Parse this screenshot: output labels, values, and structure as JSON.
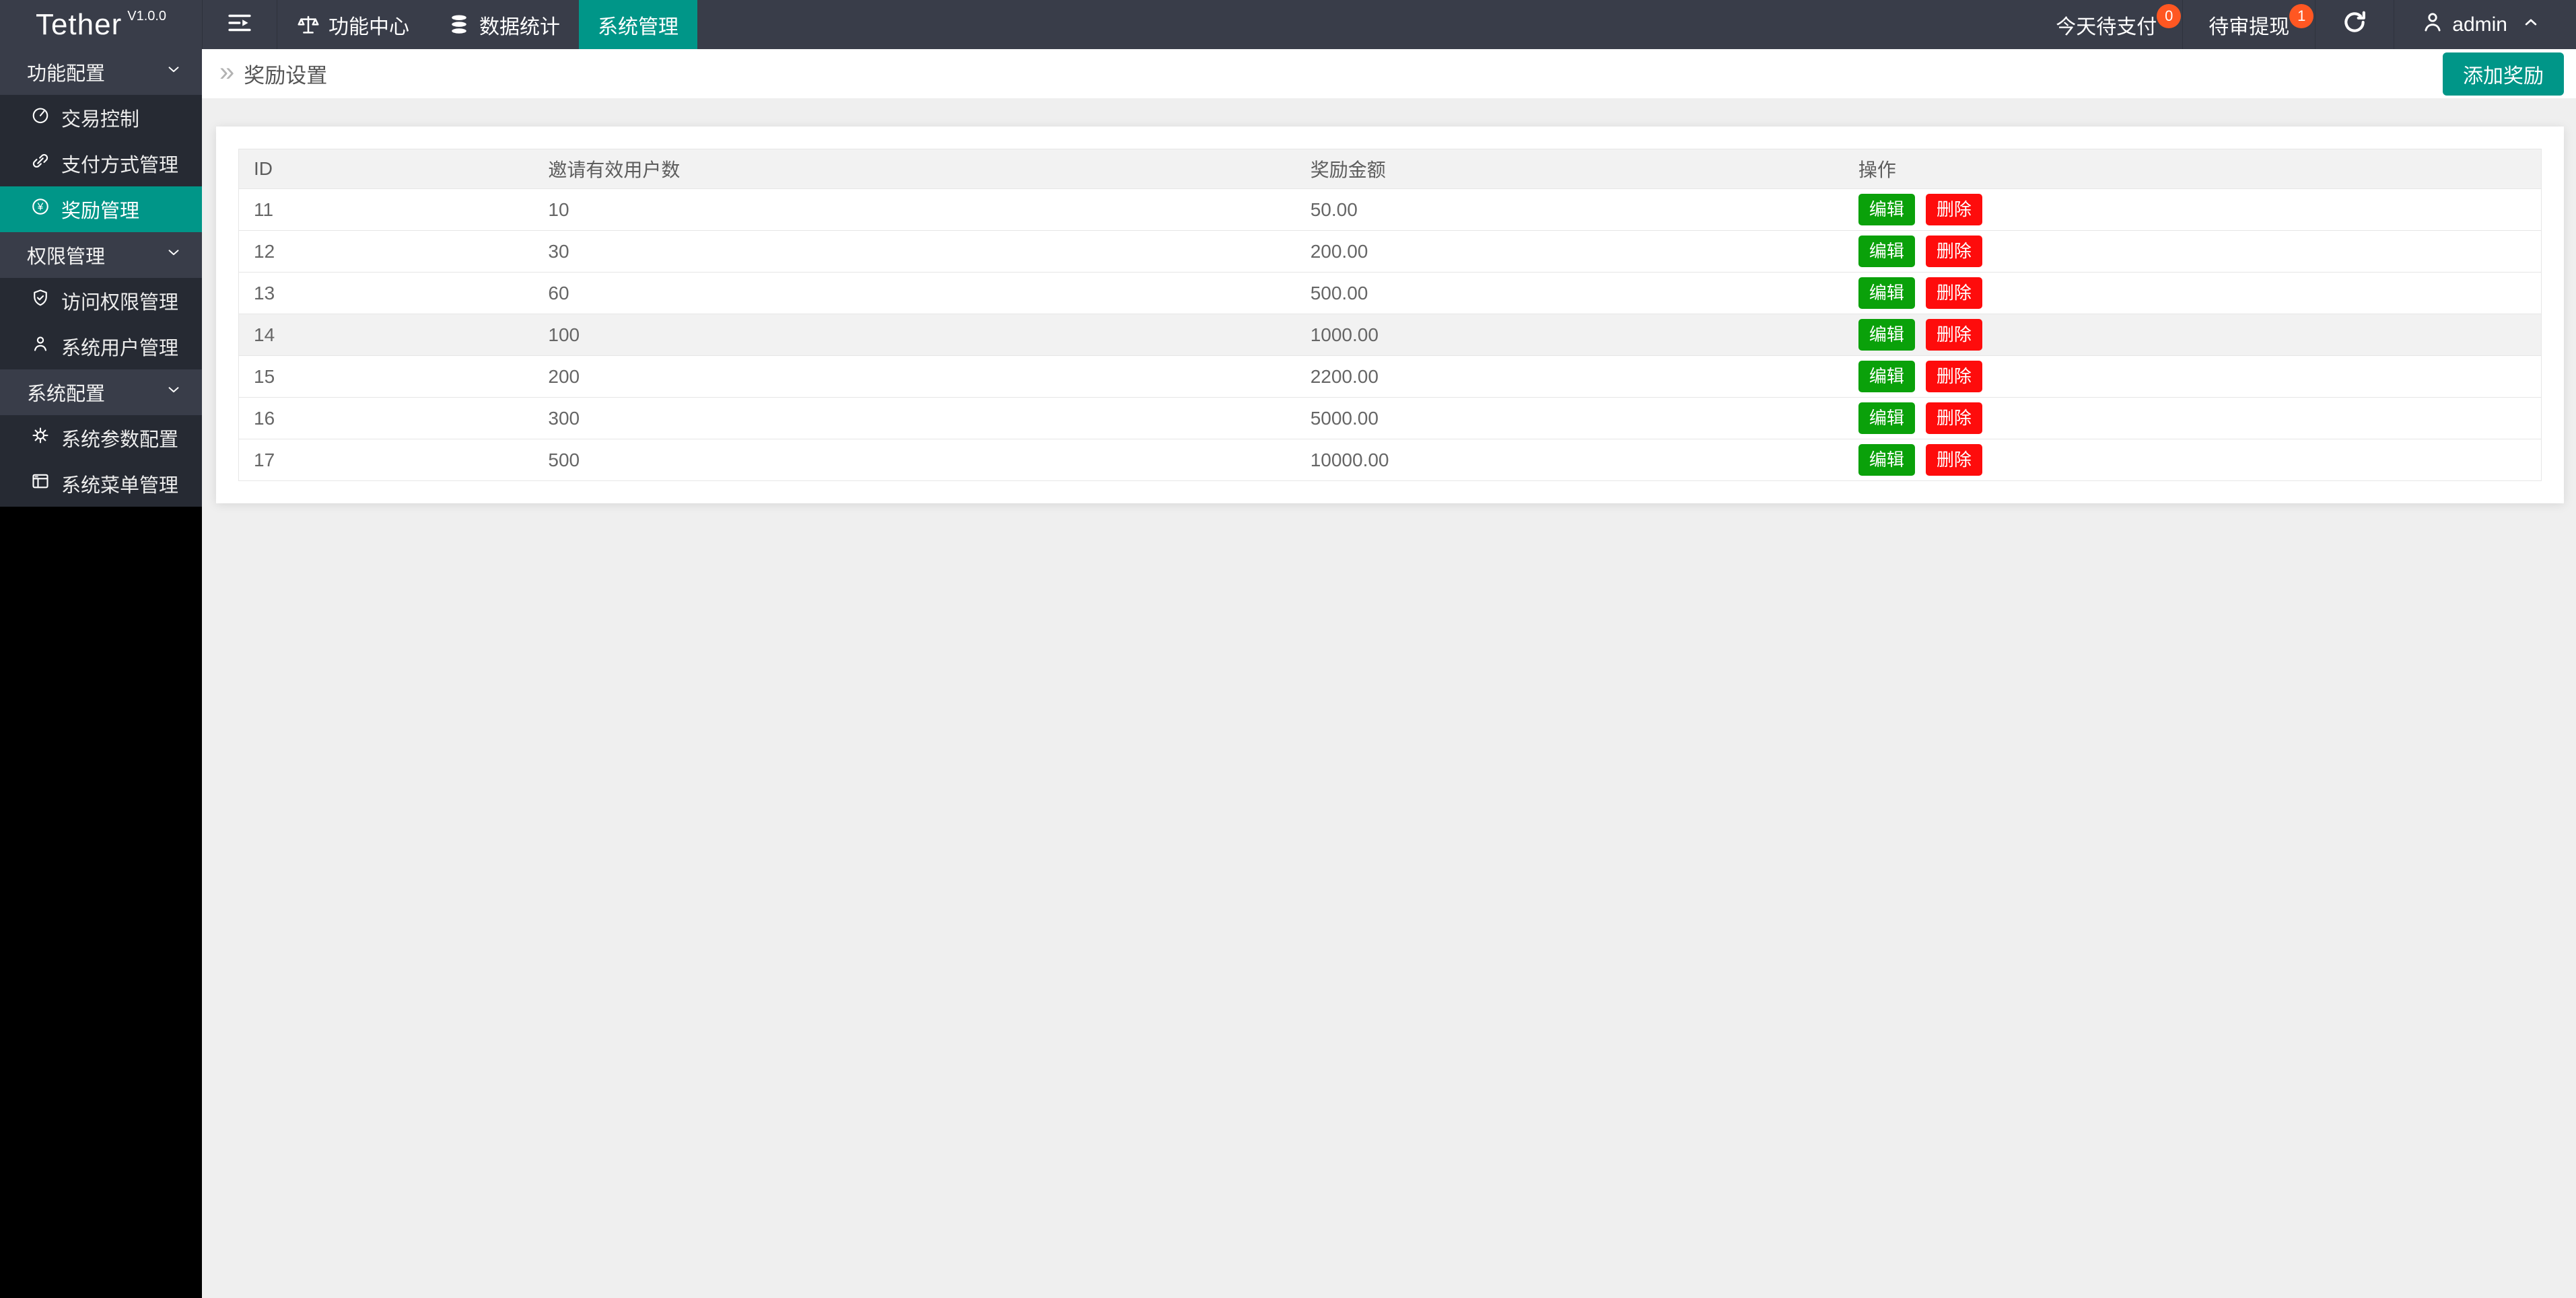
{
  "brand": {
    "name": "Tether",
    "version": "V1.0.0"
  },
  "topnav": {
    "items": [
      {
        "label": "功能中心",
        "icon": "scale-icon",
        "active": false
      },
      {
        "label": "数据统计",
        "icon": "database-icon",
        "active": false
      },
      {
        "label": "系统管理",
        "icon": null,
        "active": true
      }
    ]
  },
  "topright": {
    "pay_today": {
      "label": "今天待支付",
      "badge": "0"
    },
    "withdraw_review": {
      "label": "待审提现",
      "badge": "1"
    },
    "username": "admin"
  },
  "sidebar": {
    "sections": [
      {
        "label": "功能配置",
        "items": [
          {
            "label": "交易控制",
            "icon": "gauge-icon",
            "active": false
          },
          {
            "label": "支付方式管理",
            "icon": "link-icon",
            "active": false
          },
          {
            "label": "奖励管理",
            "icon": "yen-icon",
            "active": true
          }
        ]
      },
      {
        "label": "权限管理",
        "items": [
          {
            "label": "访问权限管理",
            "icon": "shield-check-icon",
            "active": false
          },
          {
            "label": "系统用户管理",
            "icon": "user-icon",
            "active": false
          }
        ]
      },
      {
        "label": "系统配置",
        "items": [
          {
            "label": "系统参数配置",
            "icon": "gear-icon",
            "active": false
          },
          {
            "label": "系统菜单管理",
            "icon": "window-icon",
            "active": false
          }
        ]
      }
    ]
  },
  "breadcrumb": {
    "title": "奖励设置"
  },
  "actions": {
    "add_button": "添加奖励"
  },
  "table": {
    "columns": [
      "ID",
      "邀请有效用户数",
      "奖励金额",
      "操作"
    ],
    "edit_label": "编辑",
    "delete_label": "删除",
    "highlighted_row_id": "14",
    "rows": [
      {
        "id": "11",
        "users": "10",
        "amount": "50.00"
      },
      {
        "id": "12",
        "users": "30",
        "amount": "200.00"
      },
      {
        "id": "13",
        "users": "60",
        "amount": "500.00"
      },
      {
        "id": "14",
        "users": "100",
        "amount": "1000.00"
      },
      {
        "id": "15",
        "users": "200",
        "amount": "2200.00"
      },
      {
        "id": "16",
        "users": "300",
        "amount": "5000.00"
      },
      {
        "id": "17",
        "users": "500",
        "amount": "10000.00"
      }
    ]
  },
  "colors": {
    "accent": "#009688",
    "badge": "#FF5722",
    "edit_green": "#0aa10a",
    "delete_red": "#fe0c0c",
    "topbar": "#393D49",
    "sidebar_child": "#262a33"
  }
}
